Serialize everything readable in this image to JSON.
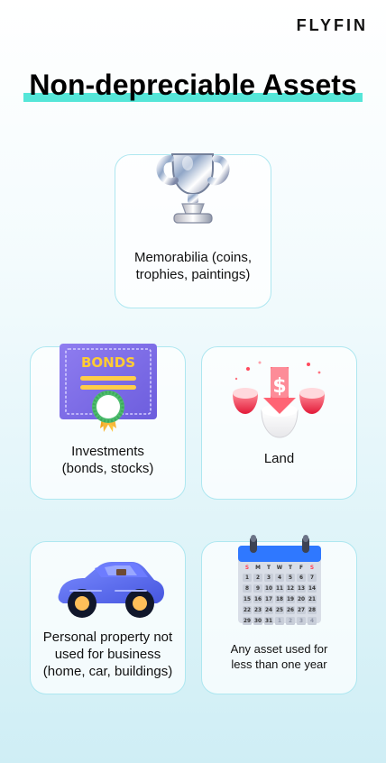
{
  "brand": "FLYFIN",
  "title": "Non-depreciable Assets",
  "cards": {
    "memorabilia": {
      "icon": "trophy-icon",
      "label": "Memorabilia (coins,\ntrophies, paintings)"
    },
    "investments": {
      "icon": "bonds-certificate-icon",
      "label": "Investments\n(bonds, stocks)",
      "badge_text": "BONDS"
    },
    "land": {
      "icon": "land-dollar-icon",
      "label": "Land",
      "symbol": "$"
    },
    "personal": {
      "icon": "car-icon",
      "label": "Personal property not\nused for business\n(home, car, buildings)"
    },
    "anyasset": {
      "icon": "calendar-icon",
      "label": "Any asset used for\nless than one year",
      "calendar_headers": [
        "S",
        "M",
        "T",
        "W",
        "T",
        "F",
        "S"
      ],
      "calendar_days": [
        "1",
        "2",
        "3",
        "4",
        "5",
        "6",
        "7",
        "8",
        "9",
        "10",
        "11",
        "12",
        "13",
        "14",
        "15",
        "16",
        "17",
        "18",
        "19",
        "20",
        "21",
        "22",
        "23",
        "24",
        "25",
        "26",
        "27",
        "28",
        "29",
        "30",
        "31",
        "1",
        "2",
        "3",
        "4"
      ]
    }
  },
  "colors": {
    "accent": "#55e6d8",
    "card_border": "#aee7f0",
    "bonds_purple": "#7e6ee8",
    "car_blue": "#4f62f0",
    "calendar_blue": "#2f78ff",
    "land_red": "#ff5f6f"
  }
}
